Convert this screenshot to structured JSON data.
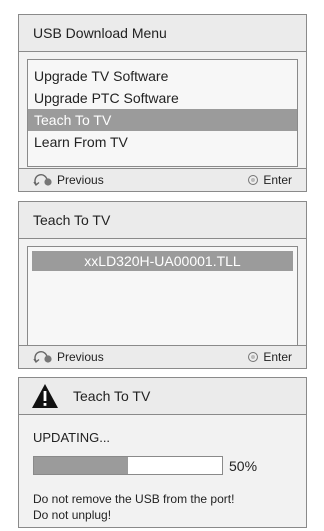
{
  "panel1": {
    "title": "USB Download Menu",
    "items": [
      {
        "label": "Upgrade TV Software",
        "selected": false
      },
      {
        "label": "Upgrade PTC Software",
        "selected": false
      },
      {
        "label": "Teach To TV",
        "selected": true
      },
      {
        "label": "Learn From TV",
        "selected": false
      }
    ],
    "footer": {
      "previous": "Previous",
      "enter": "Enter"
    }
  },
  "panel2": {
    "title": "Teach To TV",
    "file": "xxLD320H-UA00001.TLL",
    "footer": {
      "previous": "Previous",
      "enter": "Enter"
    }
  },
  "panel3": {
    "title": "Teach To TV",
    "status": "UPDATING...",
    "progress_percent": 50,
    "progress_label": "50%",
    "message_line1": "Do not remove the USB from the port!",
    "message_line2": "Do not unplug!"
  },
  "icons": {
    "previous": "return-arrow-icon",
    "enter": "enter-circle-icon",
    "warning": "warning-triangle-icon"
  },
  "colors": {
    "selected_bg": "#9b9b9b",
    "panel_bg": "#f2f2f2",
    "border": "#8a8a8a"
  }
}
